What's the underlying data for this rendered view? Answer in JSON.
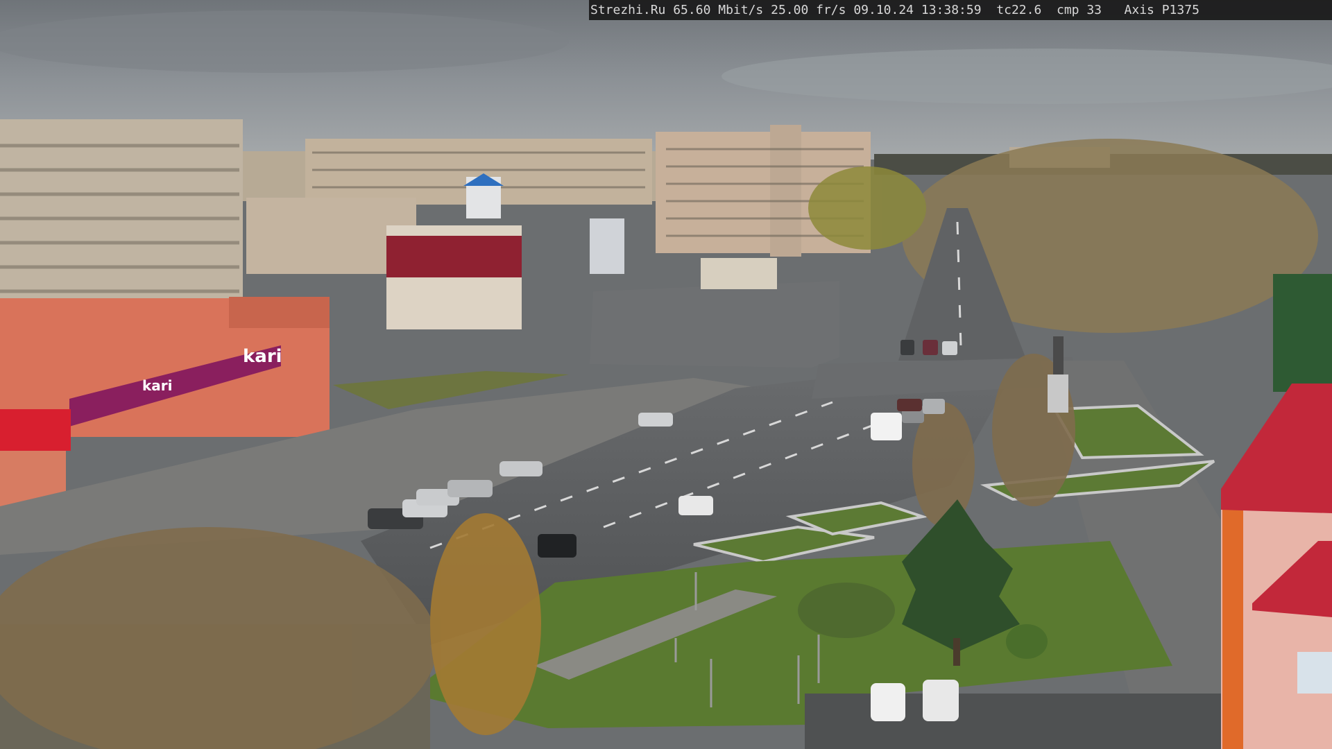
{
  "overlay": {
    "site": "Strezhi.Ru",
    "bitrate": "65.60 Mbit/s",
    "fps": "25.00 fr/s",
    "date": "09.10.24",
    "time": "13:38:59",
    "tc": "tc22.6",
    "cmp": "cmp 33",
    "camera": "Axis P1375"
  },
  "signs": {
    "store_main": "kari",
    "store_roof": "kari"
  },
  "colors": {
    "sky": "#8a8f94",
    "overlay_bg": "#191919",
    "overlay_text": "#d8d8d8",
    "store_facade": "#d9735a",
    "store_banner": "#8a1f5e",
    "road": "#5b5d60",
    "grass": "#5c7a34",
    "roof_red": "#c2283a"
  }
}
